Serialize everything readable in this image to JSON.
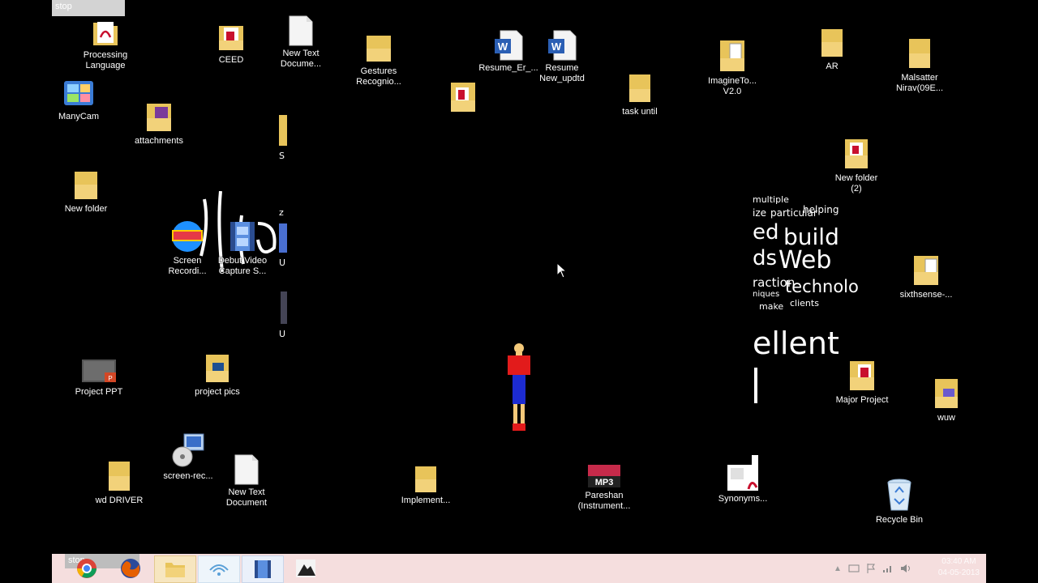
{
  "overlay": {
    "stop_top": "stop",
    "stop_taskbar": "stop"
  },
  "icons": {
    "processing": "Processing\nLanguage",
    "ceed": "CEED",
    "newtext1": "New Text\nDocume...",
    "gestures": "Gestures\nRecognio...",
    "resume_er": "Resume_Er_...",
    "resume_new": "Resume\nNew_updtd",
    "task_until": "task until",
    "imagineto": "ImagineTo...\nV2.0",
    "ar": "AR",
    "malsatter": "Malsatter\nNirav(09E...",
    "manycam": "ManyCam",
    "attachments": "attachments",
    "new_folder": "New folder",
    "new_folder2": "New folder\n(2)",
    "screen_rec_top": "Screen\nRecordi...",
    "debut": "Debut Video\nCapture S...",
    "sixthsense": "sixthsense-...",
    "project_ppt": "Project PPT",
    "project_pics": "project pics",
    "major_project": "Major Project",
    "wuw": "wuw",
    "screen_rec": "screen-rec...",
    "wd_driver": "wd DRIVER",
    "newtext2": "New Text\nDocument",
    "implement": "Implement...",
    "pareshan": "Pareshan\n(Instrument...",
    "synonyms": "Synonyms...",
    "recycle": "Recycle Bin"
  },
  "strip_left": {
    "s": "S",
    "u1": "U",
    "u2": "U",
    "z": "z"
  },
  "wordcloud": {
    "w1": "multiple",
    "w2": "ize",
    "w3": "particular",
    "w4": "helping",
    "w5": "ed",
    "w6": "build",
    "w7": "ds",
    "w8": "Web",
    "w9": "raction",
    "w10": "technology",
    "w11": "niques",
    "w12": "make",
    "w13": "clients",
    "w14": "ellent"
  },
  "tray": {
    "time": "03:40 AM",
    "date": "04-05-2013"
  },
  "colors": {
    "folder": "#e8c45a",
    "taskbar": "#f5dede",
    "figure_shirt": "#e21b1b",
    "figure_pants": "#1c2bd1"
  }
}
